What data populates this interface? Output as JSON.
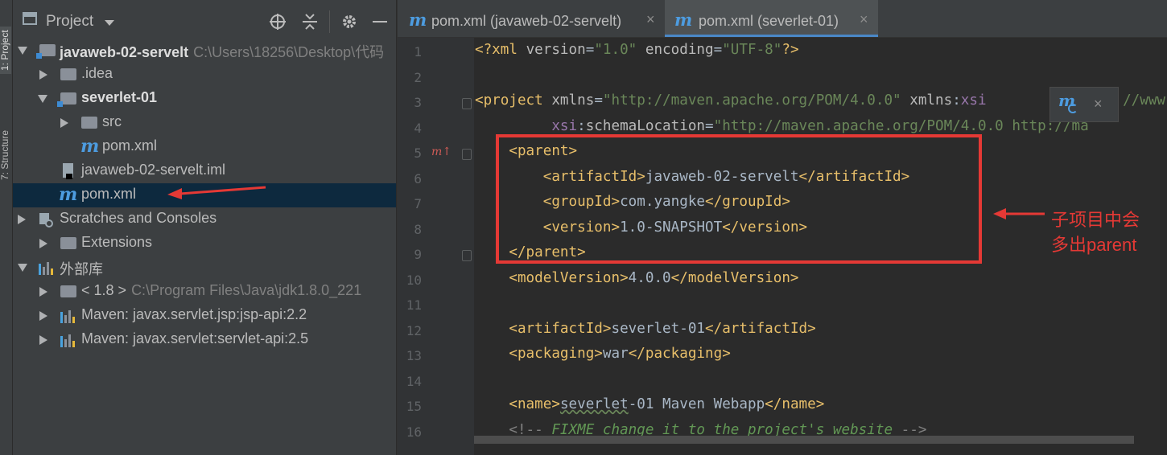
{
  "tool_strip": {
    "project_tab": "1: Project",
    "structure_tab": "7: Structure"
  },
  "project_panel": {
    "title": "Project",
    "icons": [
      "locate-icon",
      "collapse-icon",
      "gear-icon",
      "minimize-icon"
    ],
    "tree": [
      {
        "label": "javaweb-02-servelt",
        "path": "C:\\Users\\18256\\Desktop\\代码"
      },
      {
        "label": ".idea"
      },
      {
        "label": "severlet-01"
      },
      {
        "label": "src"
      },
      {
        "label": "pom.xml"
      },
      {
        "label": "javaweb-02-servelt.iml"
      },
      {
        "label": "pom.xml"
      },
      {
        "label": "Scratches and Consoles"
      },
      {
        "label": "Extensions"
      },
      {
        "label": "外部库"
      },
      {
        "label": "< 1.8 >",
        "path": "C:\\Program Files\\Java\\jdk1.8.0_221"
      },
      {
        "label": "Maven: javax.servlet.jsp:jsp-api:2.2"
      },
      {
        "label": "Maven: javax.servlet:servlet-api:2.5"
      }
    ]
  },
  "editor": {
    "tabs": [
      {
        "label": "pom.xml (javaweb-02-servelt)",
        "close": "×"
      },
      {
        "label": "pom.xml (severlet-01)",
        "close": "×"
      }
    ],
    "line_numbers": [
      "1",
      "2",
      "3",
      "4",
      "5",
      "6",
      "7",
      "8",
      "9",
      "10",
      "11",
      "12",
      "13",
      "14",
      "15",
      "16"
    ],
    "popup_close": "×",
    "annotation_lines": [
      "子项目中会",
      "多出parent"
    ]
  },
  "colors": {
    "red_annotation": "#e53935",
    "selection": "#0d293e",
    "accent_blue": "#4a88c7"
  }
}
